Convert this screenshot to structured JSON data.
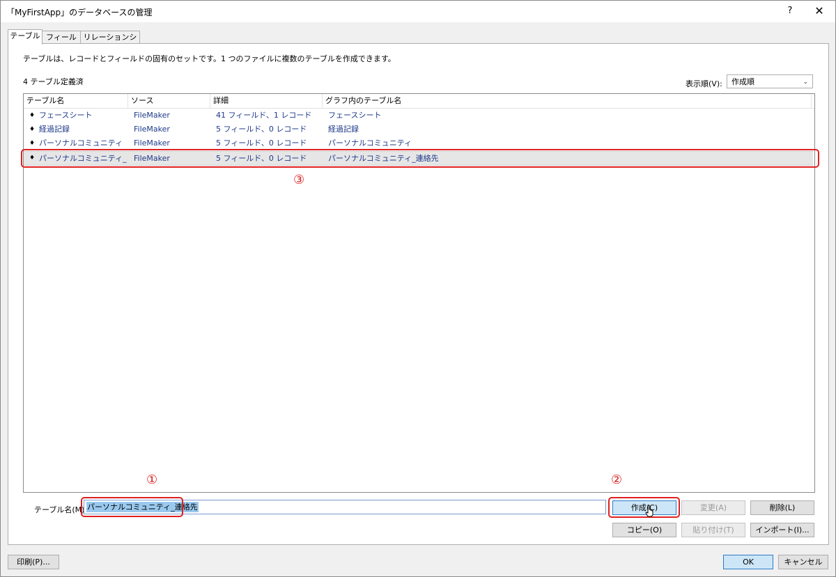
{
  "window": {
    "title": "「MyFirstApp」のデータベースの管理",
    "help_label": "?",
    "close_label": "✕"
  },
  "tabs": [
    {
      "label": "テーブル",
      "active": true
    },
    {
      "label": "フィールド",
      "active": false
    },
    {
      "label": "リレーションシップ",
      "active": false
    }
  ],
  "panel": {
    "description": "テーブルは、レコードとフィールドの固有のセットです。1 つのファイルに複数のテーブルを作成できます。",
    "count_text": "4 テーブル定義済",
    "sort_label": "表示順(V):",
    "sort_value": "作成順"
  },
  "table": {
    "columns": [
      "テーブル名",
      "ソース",
      "詳細",
      "グラフ内のテーブル名"
    ],
    "rows": [
      {
        "name": "フェースシート",
        "source": "FileMaker",
        "detail": "41 フィールド、1 レコード",
        "graph_name": "フェースシート",
        "selected": false
      },
      {
        "name": "経過記録",
        "source": "FileMaker",
        "detail": "5 フィールド、0 レコード",
        "graph_name": "経過記録",
        "selected": false
      },
      {
        "name": "パーソナルコミュニティ",
        "source": "FileMaker",
        "detail": "5 フィールド、0 レコード",
        "graph_name": "パーソナルコミュニティ",
        "selected": false
      },
      {
        "name": "パーソナルコミュニティ_連...",
        "source": "FileMaker",
        "detail": "5 フィールド、0 レコード",
        "graph_name": "パーソナルコミュニティ_連絡先",
        "selected": true
      }
    ]
  },
  "form": {
    "name_label": "テーブル名(M):",
    "name_value": "パーソナルコミュニティ_連絡先"
  },
  "buttons": {
    "create": "作成(C)",
    "change": "変更(A)",
    "delete": "削除(L)",
    "copy": "コピー(O)",
    "paste": "貼り付け(T)",
    "import": "インポート(I)...",
    "print": "印刷(P)...",
    "ok": "OK",
    "cancel": "キャンセル"
  },
  "annotations": {
    "marker1": "①",
    "marker2": "②",
    "marker3": "③",
    "color": "#e02020"
  },
  "icons": {
    "row_icon": "updown-arrows-icon",
    "dropdown": "chevron-down-icon"
  }
}
